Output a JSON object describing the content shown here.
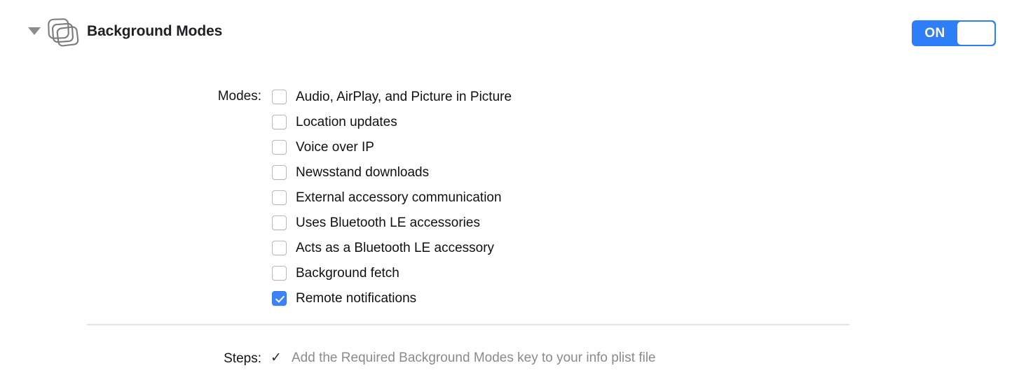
{
  "header": {
    "title": "Background Modes",
    "disclosure_icon": "disclosure-triangle-down-icon",
    "capability_icon": "stacked-squares-icon",
    "toggle": {
      "label": "ON",
      "state": "on",
      "accent_color": "#2e7ef7"
    }
  },
  "modes_section": {
    "label": "Modes:",
    "items": [
      {
        "label": "Audio, AirPlay, and Picture in Picture",
        "checked": false
      },
      {
        "label": "Location updates",
        "checked": false
      },
      {
        "label": "Voice over IP",
        "checked": false
      },
      {
        "label": "Newsstand downloads",
        "checked": false
      },
      {
        "label": "External accessory communication",
        "checked": false
      },
      {
        "label": "Uses Bluetooth LE accessories",
        "checked": false
      },
      {
        "label": "Acts as a Bluetooth LE accessory",
        "checked": false
      },
      {
        "label": "Background fetch",
        "checked": false
      },
      {
        "label": "Remote notifications",
        "checked": true
      }
    ],
    "checked_color": "#3b83f6"
  },
  "steps_section": {
    "label": "Steps:",
    "items": [
      {
        "status_icon": "checkmark-icon",
        "status_glyph": "✓",
        "text": "Add the Required Background Modes key to your info plist file",
        "text_color": "#8a8a8f"
      }
    ]
  }
}
